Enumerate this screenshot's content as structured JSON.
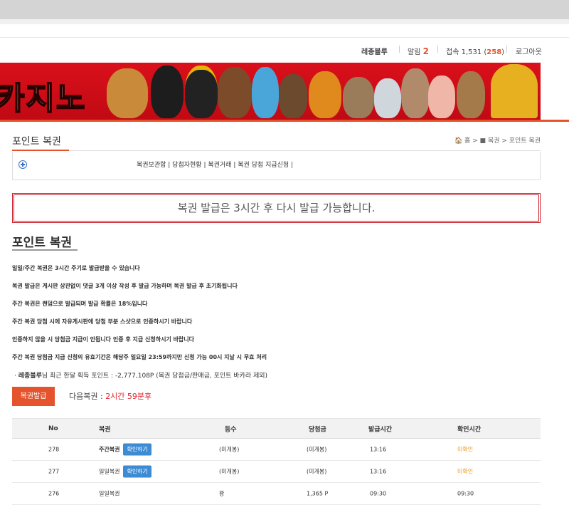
{
  "userbar": {
    "name": "레종블루",
    "alarm_label": "알림",
    "alarm_count": "2",
    "connect_label": "접속 1,531 (",
    "connect_count": "258",
    "connect_close": ")",
    "logout": "로그아웃"
  },
  "banner": {
    "text": "카지노"
  },
  "section": {
    "title": "포인트 복권",
    "breadcrumb": "🏠 홈 > ■ 복권 > 포인트 복권"
  },
  "menu": {
    "links": [
      "복권보관함",
      "당첨자현황",
      "복권거래",
      "복권 당첨 지급신청"
    ]
  },
  "notice": "복권 발급은 3시간 후 다시 발급 가능합니다.",
  "heading": "포인트 복권",
  "rules": [
    "일일/주간 복권은 3시간 주기로 발급받을 수 있습니다",
    "복권 발급은 게시판 상관없이 댓글 3개 이상 작성 후 발급 가능하며 복권 발급 후 초기화됩니다",
    "주간 복권은 랜덤으로 발급되며 발급 확률은 18%입니다",
    "주간 복권 당첨 시에 자유게시판에 당첨 부분 스샷으로 인증하시기 바랍니다",
    "인증하지 않을 시 당첨금 지급이 안됩니다 인증 후 지급 신청하시기 바랍니다",
    "주간 복권 당첨금 지급 신청의 유효기간은 해당주 일요일 23:59까지만 신청 가능 00시 지날 시 무효 처리"
  ],
  "info": {
    "bullet": "·",
    "name": "레종블루",
    "text": "님 최근 한달 획득 포인트 : -2,777,108P (복권 당첨금/판매금, 포인트 바카라 제외)"
  },
  "issue_button": "복권발급",
  "next": {
    "label": "다음복권 : ",
    "value": "2시간 59분후"
  },
  "table": {
    "headers": [
      "No",
      "복권",
      "등수",
      "당첨금",
      "발급시간",
      "확인시간"
    ],
    "rows": [
      {
        "no": "278",
        "ticket": "주간복권",
        "ticket_bold": true,
        "button": "확인하기",
        "rank": "(미개봉)",
        "prize": "(미개봉)",
        "issued": "13:16",
        "checked": "미확인"
      },
      {
        "no": "277",
        "ticket": "일일복권",
        "ticket_bold": false,
        "button": "확인하기",
        "rank": "(미개봉)",
        "prize": "(미개봉)",
        "issued": "13:16",
        "checked": "미확인"
      },
      {
        "no": "276",
        "ticket": "일일복권",
        "ticket_bold": false,
        "button": "",
        "rank": "꽝",
        "prize": "1,365 P",
        "issued": "09:30",
        "checked": "09:30"
      }
    ]
  },
  "colors": {
    "accent": "#e4532c",
    "banner_red": "#d9101b",
    "button_blue": "#3d8bd3",
    "unverified": "#e89b1c"
  }
}
